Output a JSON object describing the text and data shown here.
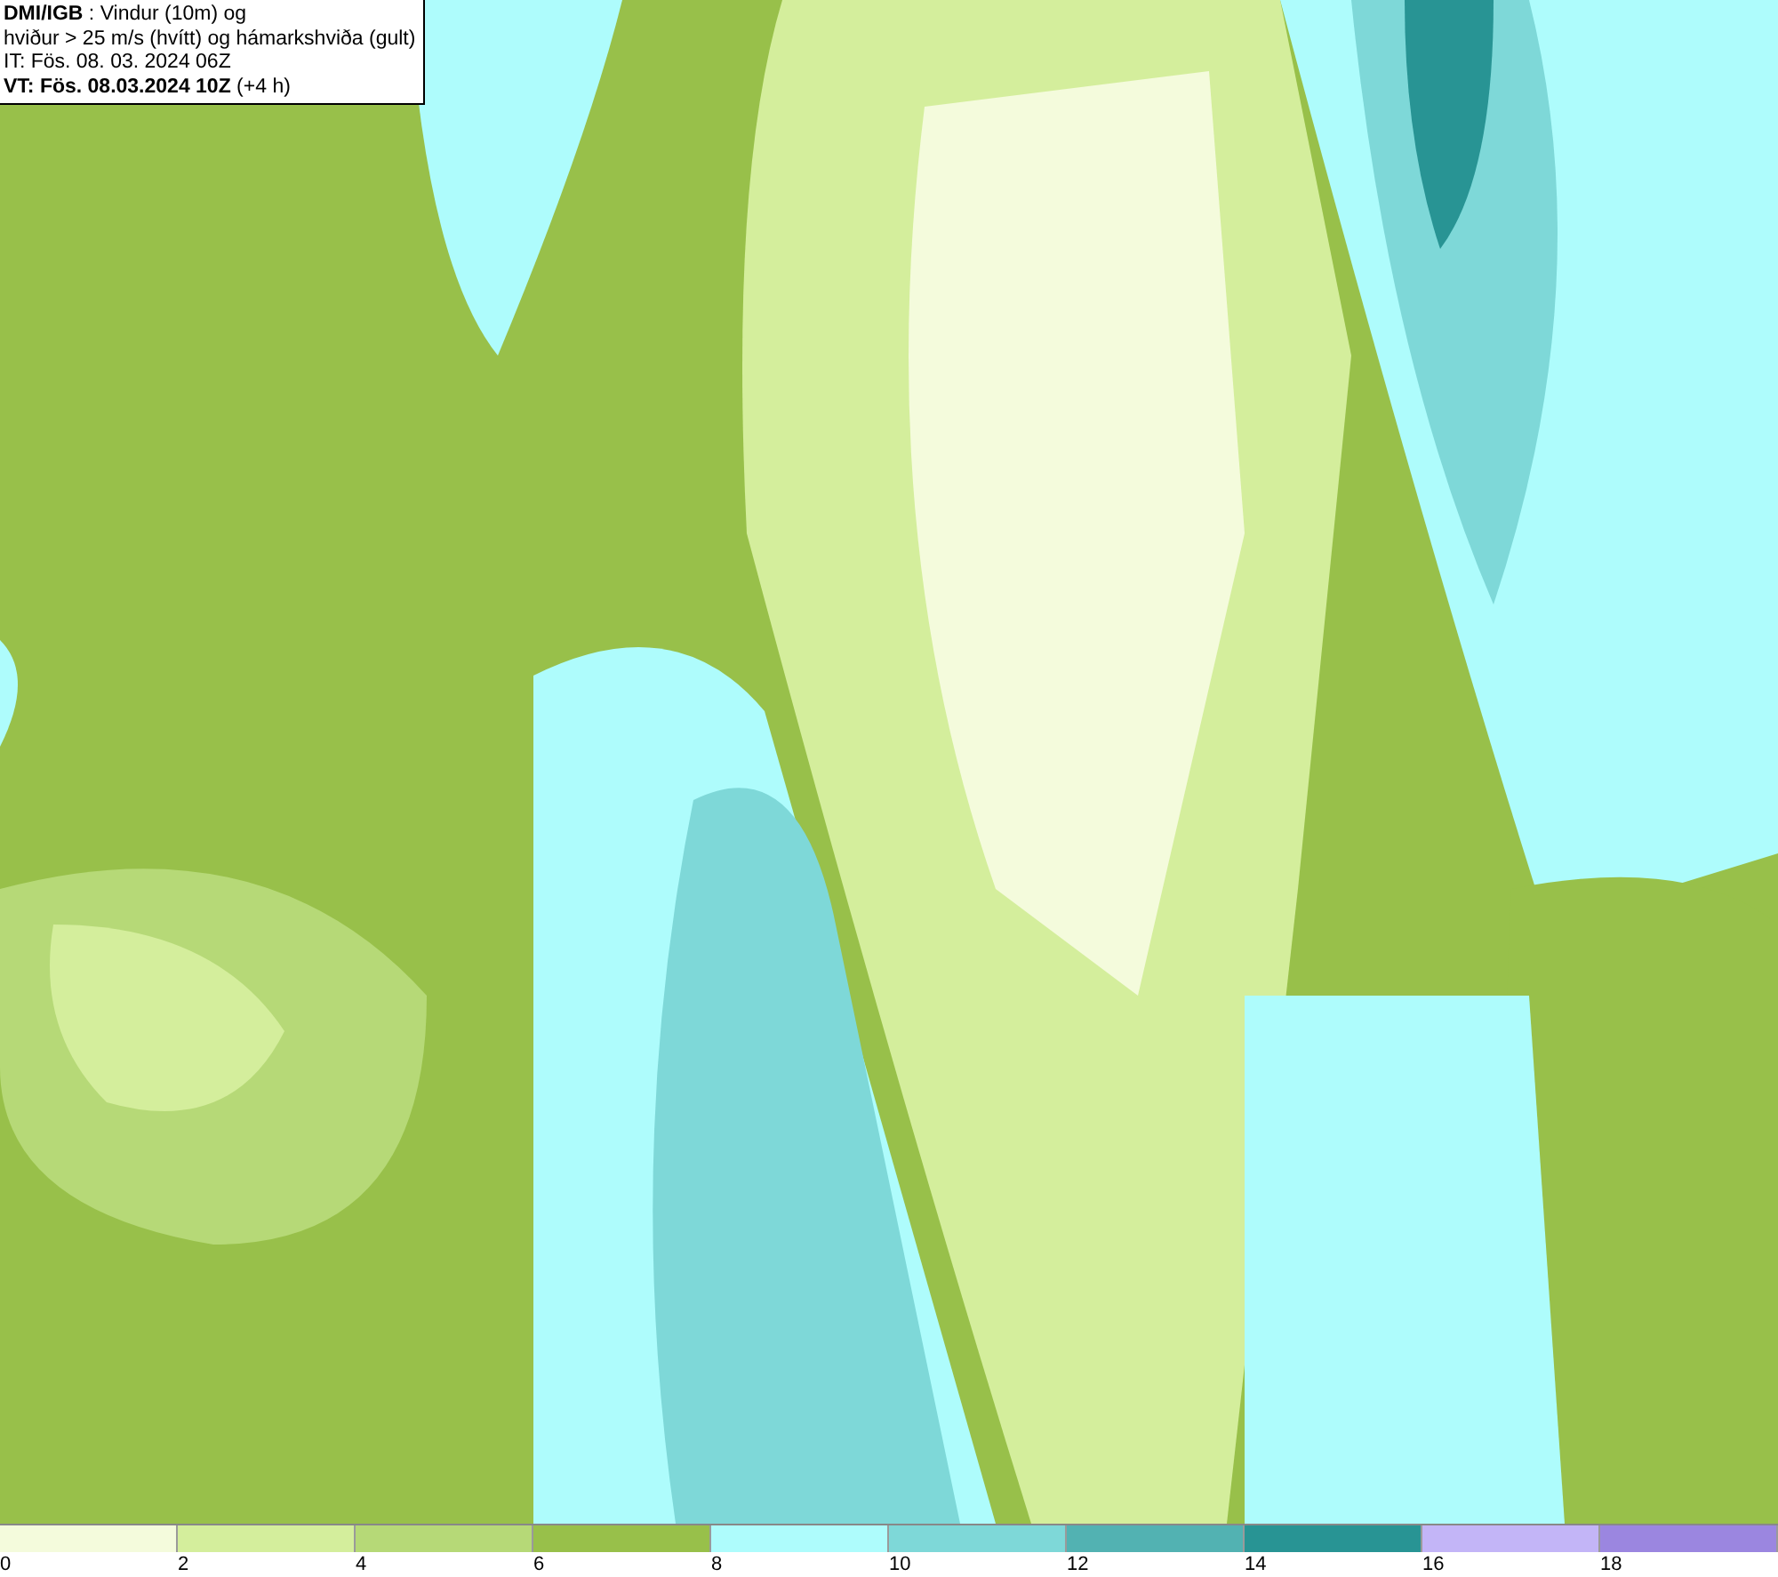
{
  "title_box": {
    "lines": [
      "**DMI/IGB** : Vindur (10m) og",
      "hviður > 25 m/s (hvítt) og hámarkshviða (gult)",
      "IT: Fös. 08. 03. 2024 06Z",
      "**VT: Fös. 08.03.2024 10Z** (+4 h)"
    ]
  },
  "legend": [
    {
      "label": "0",
      "color": "#f4fbdc"
    },
    {
      "label": "2",
      "color": "#d4ee9c"
    },
    {
      "label": "4",
      "color": "#b6d977"
    },
    {
      "label": "6",
      "color": "#98c04a"
    },
    {
      "label": "8",
      "color": "#aefcfc"
    },
    {
      "label": "10",
      "color": "#7ed8d8"
    },
    {
      "label": "12",
      "color": "#52b2b2"
    },
    {
      "label": "14",
      "color": "#289494"
    },
    {
      "label": "16",
      "color": "#c3b5f7"
    },
    {
      "label": "18",
      "color": "#9b86e0"
    }
  ]
}
